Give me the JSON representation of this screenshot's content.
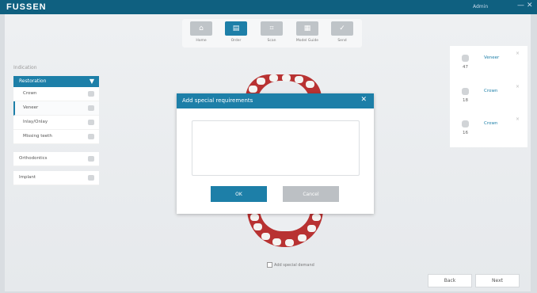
{
  "app": {
    "logo": "FUSSEN",
    "user": "Admin",
    "minimize": "—",
    "close": "✕"
  },
  "toolbar": {
    "items": [
      {
        "label": "Home",
        "icon": "⌂"
      },
      {
        "label": "Order",
        "icon": "▤"
      },
      {
        "label": "Scan",
        "icon": "⌗"
      },
      {
        "label": "Model Guide",
        "icon": "▦"
      },
      {
        "label": "Send",
        "icon": "✓"
      }
    ]
  },
  "sidebar": {
    "indication_label": "Indication",
    "restoration": {
      "header": "Restoration",
      "caret": "▼",
      "items": [
        {
          "label": "Crown"
        },
        {
          "label": "Veneer"
        },
        {
          "label": "Inlay/Onlay"
        },
        {
          "label": "Missing teeth"
        }
      ]
    },
    "orthodontics": {
      "label": "Orthodontics"
    },
    "implant": {
      "label": "Implant"
    }
  },
  "right_panel": {
    "items": [
      {
        "number": "47",
        "name": "Veneer"
      },
      {
        "number": "18",
        "name": "Crown"
      },
      {
        "number": "16",
        "name": "Crown"
      }
    ],
    "remove": "×"
  },
  "dialog": {
    "title": "Add special requirements",
    "close": "✕",
    "text_value": "",
    "ok_label": "OK",
    "cancel_label": "Cancel"
  },
  "footer": {
    "special_demand": "Add special demand",
    "back": "Back",
    "next": "Next"
  }
}
